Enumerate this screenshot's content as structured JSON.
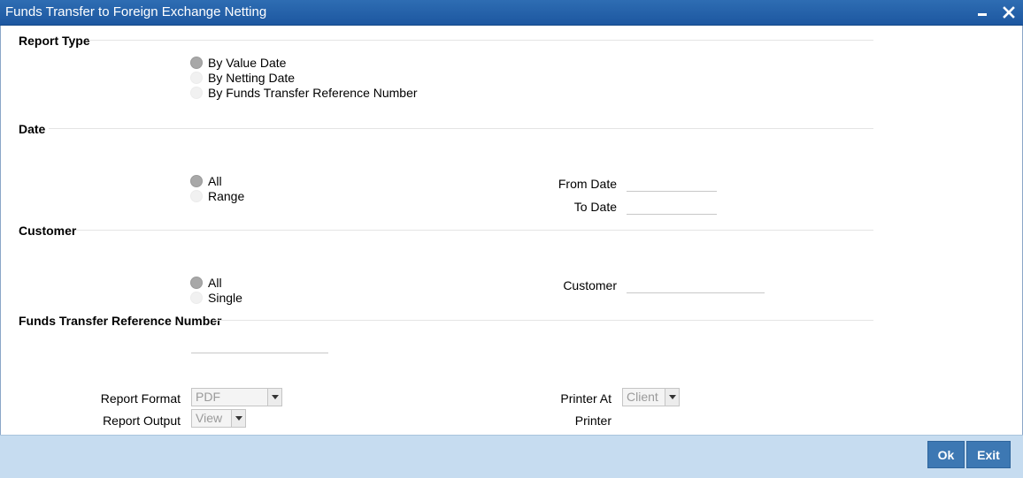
{
  "window": {
    "title": "Funds Transfer to Foreign Exchange Netting"
  },
  "report_type": {
    "heading": "Report Type",
    "options": [
      "By Value Date",
      "By Netting Date",
      "By Funds Transfer Reference Number"
    ],
    "selected": "By Value Date"
  },
  "date": {
    "heading": "Date",
    "options": [
      "All",
      "Range"
    ],
    "selected": "All",
    "from_label": "From Date",
    "from_value": "",
    "to_label": "To Date",
    "to_value": ""
  },
  "customer": {
    "heading": "Customer",
    "options": [
      "All",
      "Single"
    ],
    "selected": "All",
    "customer_label": "Customer",
    "customer_value": ""
  },
  "ft_ref": {
    "heading": "Funds Transfer Reference Number",
    "value": ""
  },
  "report": {
    "format_label": "Report Format",
    "format_value": "PDF",
    "output_label": "Report Output",
    "output_value": "View",
    "printer_at_label": "Printer At",
    "printer_at_value": "Client",
    "printer_label": "Printer"
  },
  "footer": {
    "ok_label": "Ok",
    "exit_label": "Exit"
  }
}
